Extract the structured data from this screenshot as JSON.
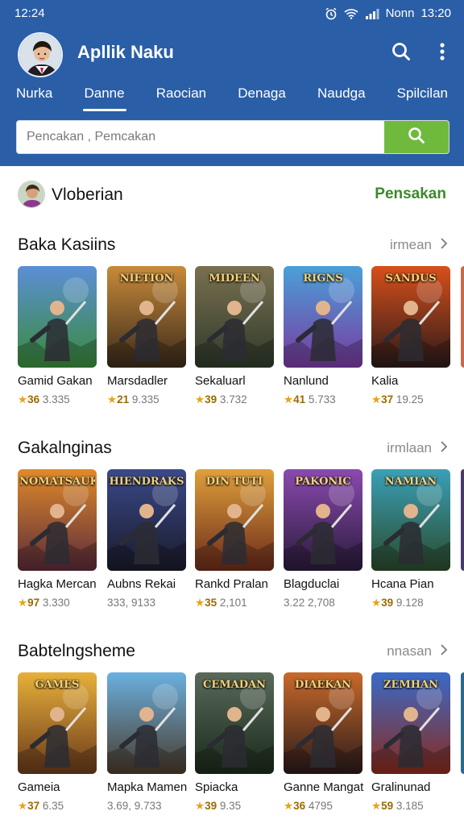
{
  "status": {
    "time_left": "12:24",
    "carrier": "Nonn",
    "time_right": "13:20"
  },
  "app": {
    "title": "Apllik Naku"
  },
  "tabs": [
    "Nurka",
    "Danne",
    "Raocian",
    "Denaga",
    "Naudga",
    "Spilcilan"
  ],
  "active_tab": 1,
  "search": {
    "placeholder": "Pencakan , Pemcakan"
  },
  "profile": {
    "name": "Vloberian",
    "action": "Pensakan"
  },
  "sections": [
    {
      "title": "Baka Kasiins",
      "more": "irmean",
      "items": [
        {
          "name": "Gamid Gakan",
          "rating": "36",
          "count": "3.335",
          "cover_text": "",
          "colors": [
            "#5b8fd6",
            "#3a8a3a"
          ]
        },
        {
          "name": "Marsdadler",
          "rating": "21",
          "count": "9.335",
          "cover_text": "NIETION",
          "colors": [
            "#c88a3a",
            "#3a2a1a"
          ]
        },
        {
          "name": "Sekaluarl",
          "rating": "39",
          "count": "3.732",
          "cover_text": "MIDEEN",
          "colors": [
            "#7a7050",
            "#2e3a2a"
          ]
        },
        {
          "name": "Nanlund",
          "rating": "41",
          "count": "5.733",
          "cover_text": "RIGNS",
          "colors": [
            "#4aa0d8",
            "#7a3aa0"
          ]
        },
        {
          "name": "Kalia",
          "rating": "37",
          "count": "19.25",
          "cover_text": "SANDUS",
          "colors": [
            "#d8501a",
            "#2a1a1a"
          ]
        }
      ]
    },
    {
      "title": "Gakalnginas",
      "more": "irmlaan",
      "items": [
        {
          "name": "Hagka Mercan",
          "rating": "97",
          "count": "3.330",
          "cover_text": "NOMATSAUK",
          "colors": [
            "#e08a2a",
            "#5a2a3a"
          ]
        },
        {
          "name": "Aubns Rekai",
          "rating": "",
          "count": "333, 9133",
          "cover_text": "HIENDRAKS",
          "colors": [
            "#3a4a8a",
            "#1a1a2a"
          ]
        },
        {
          "name": "Rankd Pralan",
          "rating": "35",
          "count": "2,101",
          "cover_text": "DIN TUTI",
          "colors": [
            "#e0a03a",
            "#6a2a1a"
          ]
        },
        {
          "name": "Blagduclai",
          "rating": "",
          "count": "3.22 2,708",
          "cover_text": "PAKONIC",
          "colors": [
            "#8a4ab0",
            "#2a1a3a"
          ]
        },
        {
          "name": "Hcana Pian",
          "rating": "39",
          "count": "9.128",
          "cover_text": "NAMIAN",
          "colors": [
            "#3aa0b8",
            "#2a4a2a"
          ]
        }
      ]
    },
    {
      "title": "Babtelngsheme",
      "more": "nnasan",
      "items": [
        {
          "name": "Gameia",
          "rating": "37",
          "count": "6.35",
          "cover_text": "GAMES",
          "colors": [
            "#e8b03a",
            "#6a3a1a"
          ]
        },
        {
          "name": "Mapka Mamen",
          "rating": "",
          "count": "3.69, 9.733",
          "cover_text": "",
          "colors": [
            "#6ab0e0",
            "#4a3a2a"
          ]
        },
        {
          "name": "Spiacka",
          "rating": "39",
          "count": "9.35",
          "cover_text": "CEMADAN",
          "colors": [
            "#5a6a5a",
            "#1a2a1a"
          ]
        },
        {
          "name": "Ganne Mangat",
          "rating": "36",
          "count": "4795",
          "cover_text": "DIAEKAN",
          "colors": [
            "#c86a2a",
            "#2a1a1a"
          ]
        },
        {
          "name": "Gralinunad",
          "rating": "59",
          "count": "3.185",
          "cover_text": "ZEMHAN",
          "colors": [
            "#3a6ac8",
            "#8a2a1a"
          ]
        }
      ]
    }
  ],
  "icons": {
    "search": "search-icon",
    "more": "more-vert-icon",
    "chevron": "chevron-right-icon",
    "star": "star-icon",
    "alarm": "alarm-icon",
    "wifi": "wifi-icon",
    "signal": "signal-icon"
  },
  "colors": {
    "primary": "#2a5ea7",
    "accent_green": "#6fba3c",
    "action_green": "#3b8a2a",
    "star": "#e8a317"
  }
}
